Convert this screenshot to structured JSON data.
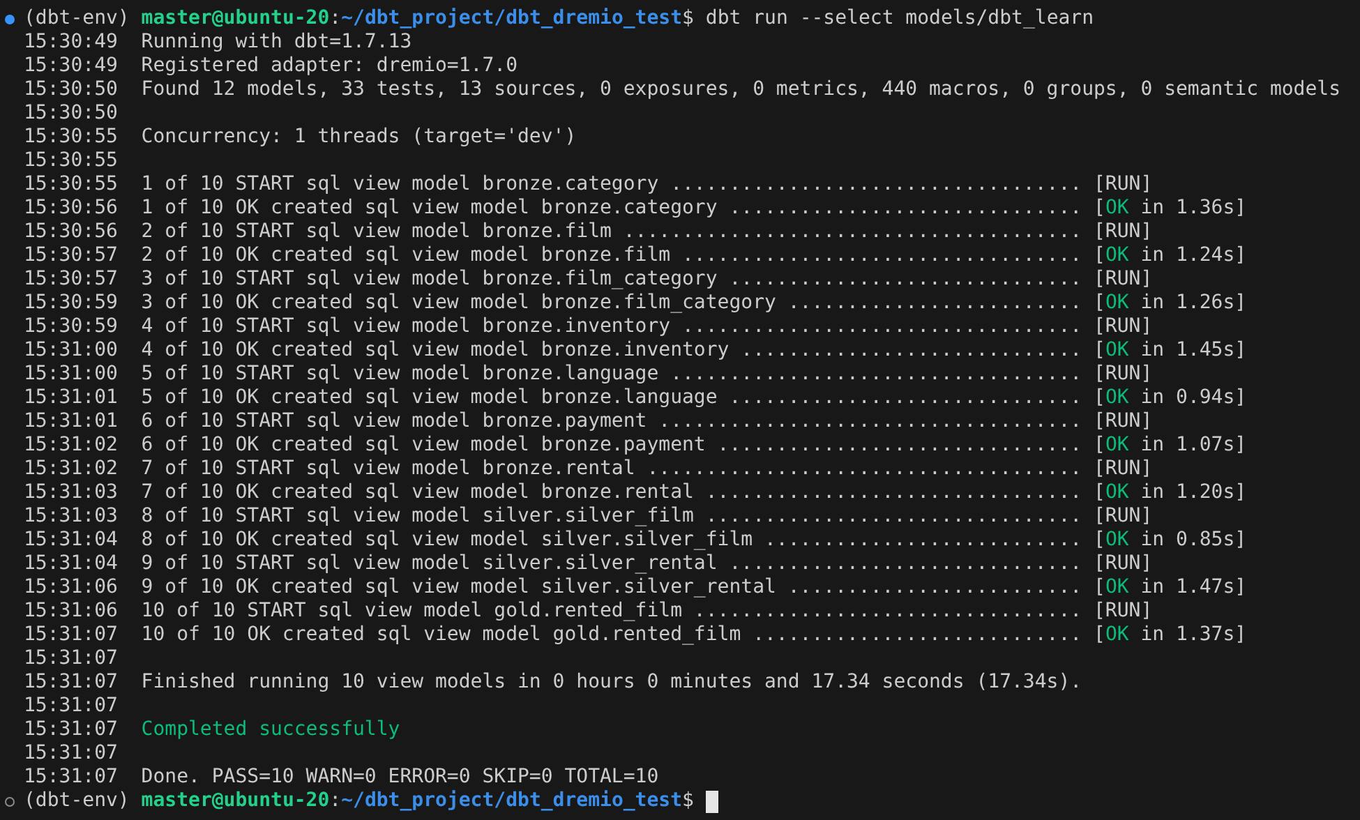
{
  "terminal": {
    "lines": [
      {
        "kind": "prompt",
        "succeeded": true,
        "cursor": false,
        "segments": [
          {
            "text": "(dbt-env) ",
            "kind": "plain"
          },
          {
            "text": "master@ubuntu-20",
            "kind": "user"
          },
          {
            "text": ":",
            "kind": "plain"
          },
          {
            "text": "~/dbt_project/dbt_dremio_test",
            "kind": "path"
          },
          {
            "text": "$ dbt run --select models/dbt_learn",
            "kind": "plain"
          }
        ]
      },
      {
        "kind": "log",
        "time": "15:30:49",
        "segments": [
          {
            "text": "Running with dbt=1.7.13",
            "kind": "plain"
          }
        ]
      },
      {
        "kind": "log",
        "time": "15:30:49",
        "segments": [
          {
            "text": "Registered adapter: dremio=1.7.0",
            "kind": "plain"
          }
        ]
      },
      {
        "kind": "log",
        "time": "15:30:50",
        "segments": [
          {
            "text": "Found 12 models, 33 tests, 13 sources, 0 exposures, 0 metrics, 440 macros, 0 groups, 0 semantic models",
            "kind": "plain"
          }
        ]
      },
      {
        "kind": "log",
        "time": "15:30:50"
      },
      {
        "kind": "log",
        "time": "15:30:55",
        "segments": [
          {
            "text": "Concurrency: 1 threads (target='dev')",
            "kind": "plain"
          }
        ]
      },
      {
        "kind": "log",
        "time": "15:30:55"
      },
      {
        "kind": "log",
        "time": "15:30:55",
        "segments": [
          {
            "text": "1 of 10 START sql view model bronze.category ................................... [RUN]",
            "kind": "plain"
          }
        ]
      },
      {
        "kind": "log",
        "time": "15:30:56",
        "segments": [
          {
            "text": "1 of 10 OK created sql view model bronze.category .............................. [",
            "kind": "plain"
          },
          {
            "text": "OK",
            "kind": "ok"
          },
          {
            "text": " in 1.36s]",
            "kind": "plain"
          }
        ]
      },
      {
        "kind": "log",
        "time": "15:30:56",
        "segments": [
          {
            "text": "2 of 10 START sql view model bronze.film ....................................... [RUN]",
            "kind": "plain"
          }
        ]
      },
      {
        "kind": "log",
        "time": "15:30:57",
        "segments": [
          {
            "text": "2 of 10 OK created sql view model bronze.film .................................. [",
            "kind": "plain"
          },
          {
            "text": "OK",
            "kind": "ok"
          },
          {
            "text": " in 1.24s]",
            "kind": "plain"
          }
        ]
      },
      {
        "kind": "log",
        "time": "15:30:57",
        "segments": [
          {
            "text": "3 of 10 START sql view model bronze.film_category .............................. [RUN]",
            "kind": "plain"
          }
        ]
      },
      {
        "kind": "log",
        "time": "15:30:59",
        "segments": [
          {
            "text": "3 of 10 OK created sql view model bronze.film_category ......................... [",
            "kind": "plain"
          },
          {
            "text": "OK",
            "kind": "ok"
          },
          {
            "text": " in 1.26s]",
            "kind": "plain"
          }
        ]
      },
      {
        "kind": "log",
        "time": "15:30:59",
        "segments": [
          {
            "text": "4 of 10 START sql view model bronze.inventory .................................. [RUN]",
            "kind": "plain"
          }
        ]
      },
      {
        "kind": "log",
        "time": "15:31:00",
        "segments": [
          {
            "text": "4 of 10 OK created sql view model bronze.inventory ............................. [",
            "kind": "plain"
          },
          {
            "text": "OK",
            "kind": "ok"
          },
          {
            "text": " in 1.45s]",
            "kind": "plain"
          }
        ]
      },
      {
        "kind": "log",
        "time": "15:31:00",
        "segments": [
          {
            "text": "5 of 10 START sql view model bronze.language ................................... [RUN]",
            "kind": "plain"
          }
        ]
      },
      {
        "kind": "log",
        "time": "15:31:01",
        "segments": [
          {
            "text": "5 of 10 OK created sql view model bronze.language .............................. [",
            "kind": "plain"
          },
          {
            "text": "OK",
            "kind": "ok"
          },
          {
            "text": " in 0.94s]",
            "kind": "plain"
          }
        ]
      },
      {
        "kind": "log",
        "time": "15:31:01",
        "segments": [
          {
            "text": "6 of 10 START sql view model bronze.payment .................................... [RUN]",
            "kind": "plain"
          }
        ]
      },
      {
        "kind": "log",
        "time": "15:31:02",
        "segments": [
          {
            "text": "6 of 10 OK created sql view model bronze.payment ............................... [",
            "kind": "plain"
          },
          {
            "text": "OK",
            "kind": "ok"
          },
          {
            "text": " in 1.07s]",
            "kind": "plain"
          }
        ]
      },
      {
        "kind": "log",
        "time": "15:31:02",
        "segments": [
          {
            "text": "7 of 10 START sql view model bronze.rental ..................................... [RUN]",
            "kind": "plain"
          }
        ]
      },
      {
        "kind": "log",
        "time": "15:31:03",
        "segments": [
          {
            "text": "7 of 10 OK created sql view model bronze.rental ................................ [",
            "kind": "plain"
          },
          {
            "text": "OK",
            "kind": "ok"
          },
          {
            "text": " in 1.20s]",
            "kind": "plain"
          }
        ]
      },
      {
        "kind": "log",
        "time": "15:31:03",
        "segments": [
          {
            "text": "8 of 10 START sql view model silver.silver_film ................................ [RUN]",
            "kind": "plain"
          }
        ]
      },
      {
        "kind": "log",
        "time": "15:31:04",
        "segments": [
          {
            "text": "8 of 10 OK created sql view model silver.silver_film ........................... [",
            "kind": "plain"
          },
          {
            "text": "OK",
            "kind": "ok"
          },
          {
            "text": " in 0.85s]",
            "kind": "plain"
          }
        ]
      },
      {
        "kind": "log",
        "time": "15:31:04",
        "segments": [
          {
            "text": "9 of 10 START sql view model silver.silver_rental .............................. [RUN]",
            "kind": "plain"
          }
        ]
      },
      {
        "kind": "log",
        "time": "15:31:06",
        "segments": [
          {
            "text": "9 of 10 OK created sql view model silver.silver_rental ......................... [",
            "kind": "plain"
          },
          {
            "text": "OK",
            "kind": "ok"
          },
          {
            "text": " in 1.47s]",
            "kind": "plain"
          }
        ]
      },
      {
        "kind": "log",
        "time": "15:31:06",
        "segments": [
          {
            "text": "10 of 10 START sql view model gold.rented_film ................................. [RUN]",
            "kind": "plain"
          }
        ]
      },
      {
        "kind": "log",
        "time": "15:31:07",
        "segments": [
          {
            "text": "10 of 10 OK created sql view model gold.rented_film ............................ [",
            "kind": "plain"
          },
          {
            "text": "OK",
            "kind": "ok"
          },
          {
            "text": " in 1.37s]",
            "kind": "plain"
          }
        ]
      },
      {
        "kind": "log",
        "time": "15:31:07"
      },
      {
        "kind": "log",
        "time": "15:31:07",
        "segments": [
          {
            "text": "Finished running 10 view models in 0 hours 0 minutes and 17.34 seconds (17.34s).",
            "kind": "plain"
          }
        ]
      },
      {
        "kind": "log",
        "time": "15:31:07"
      },
      {
        "kind": "log",
        "time": "15:31:07",
        "segments": [
          {
            "text": "Completed successfully",
            "kind": "ok"
          }
        ]
      },
      {
        "kind": "log",
        "time": "15:31:07"
      },
      {
        "kind": "log",
        "time": "15:31:07",
        "segments": [
          {
            "text": "Done. PASS=10 WARN=0 ERROR=0 SKIP=0 TOTAL=10",
            "kind": "plain"
          }
        ]
      },
      {
        "kind": "prompt",
        "succeeded": false,
        "cursor": true,
        "segments": [
          {
            "text": "(dbt-env) ",
            "kind": "plain"
          },
          {
            "text": "master@ubuntu-20",
            "kind": "user"
          },
          {
            "text": ":",
            "kind": "plain"
          },
          {
            "text": "~/dbt_project/dbt_dremio_test",
            "kind": "path"
          },
          {
            "text": "$ ",
            "kind": "plain"
          }
        ]
      }
    ]
  }
}
